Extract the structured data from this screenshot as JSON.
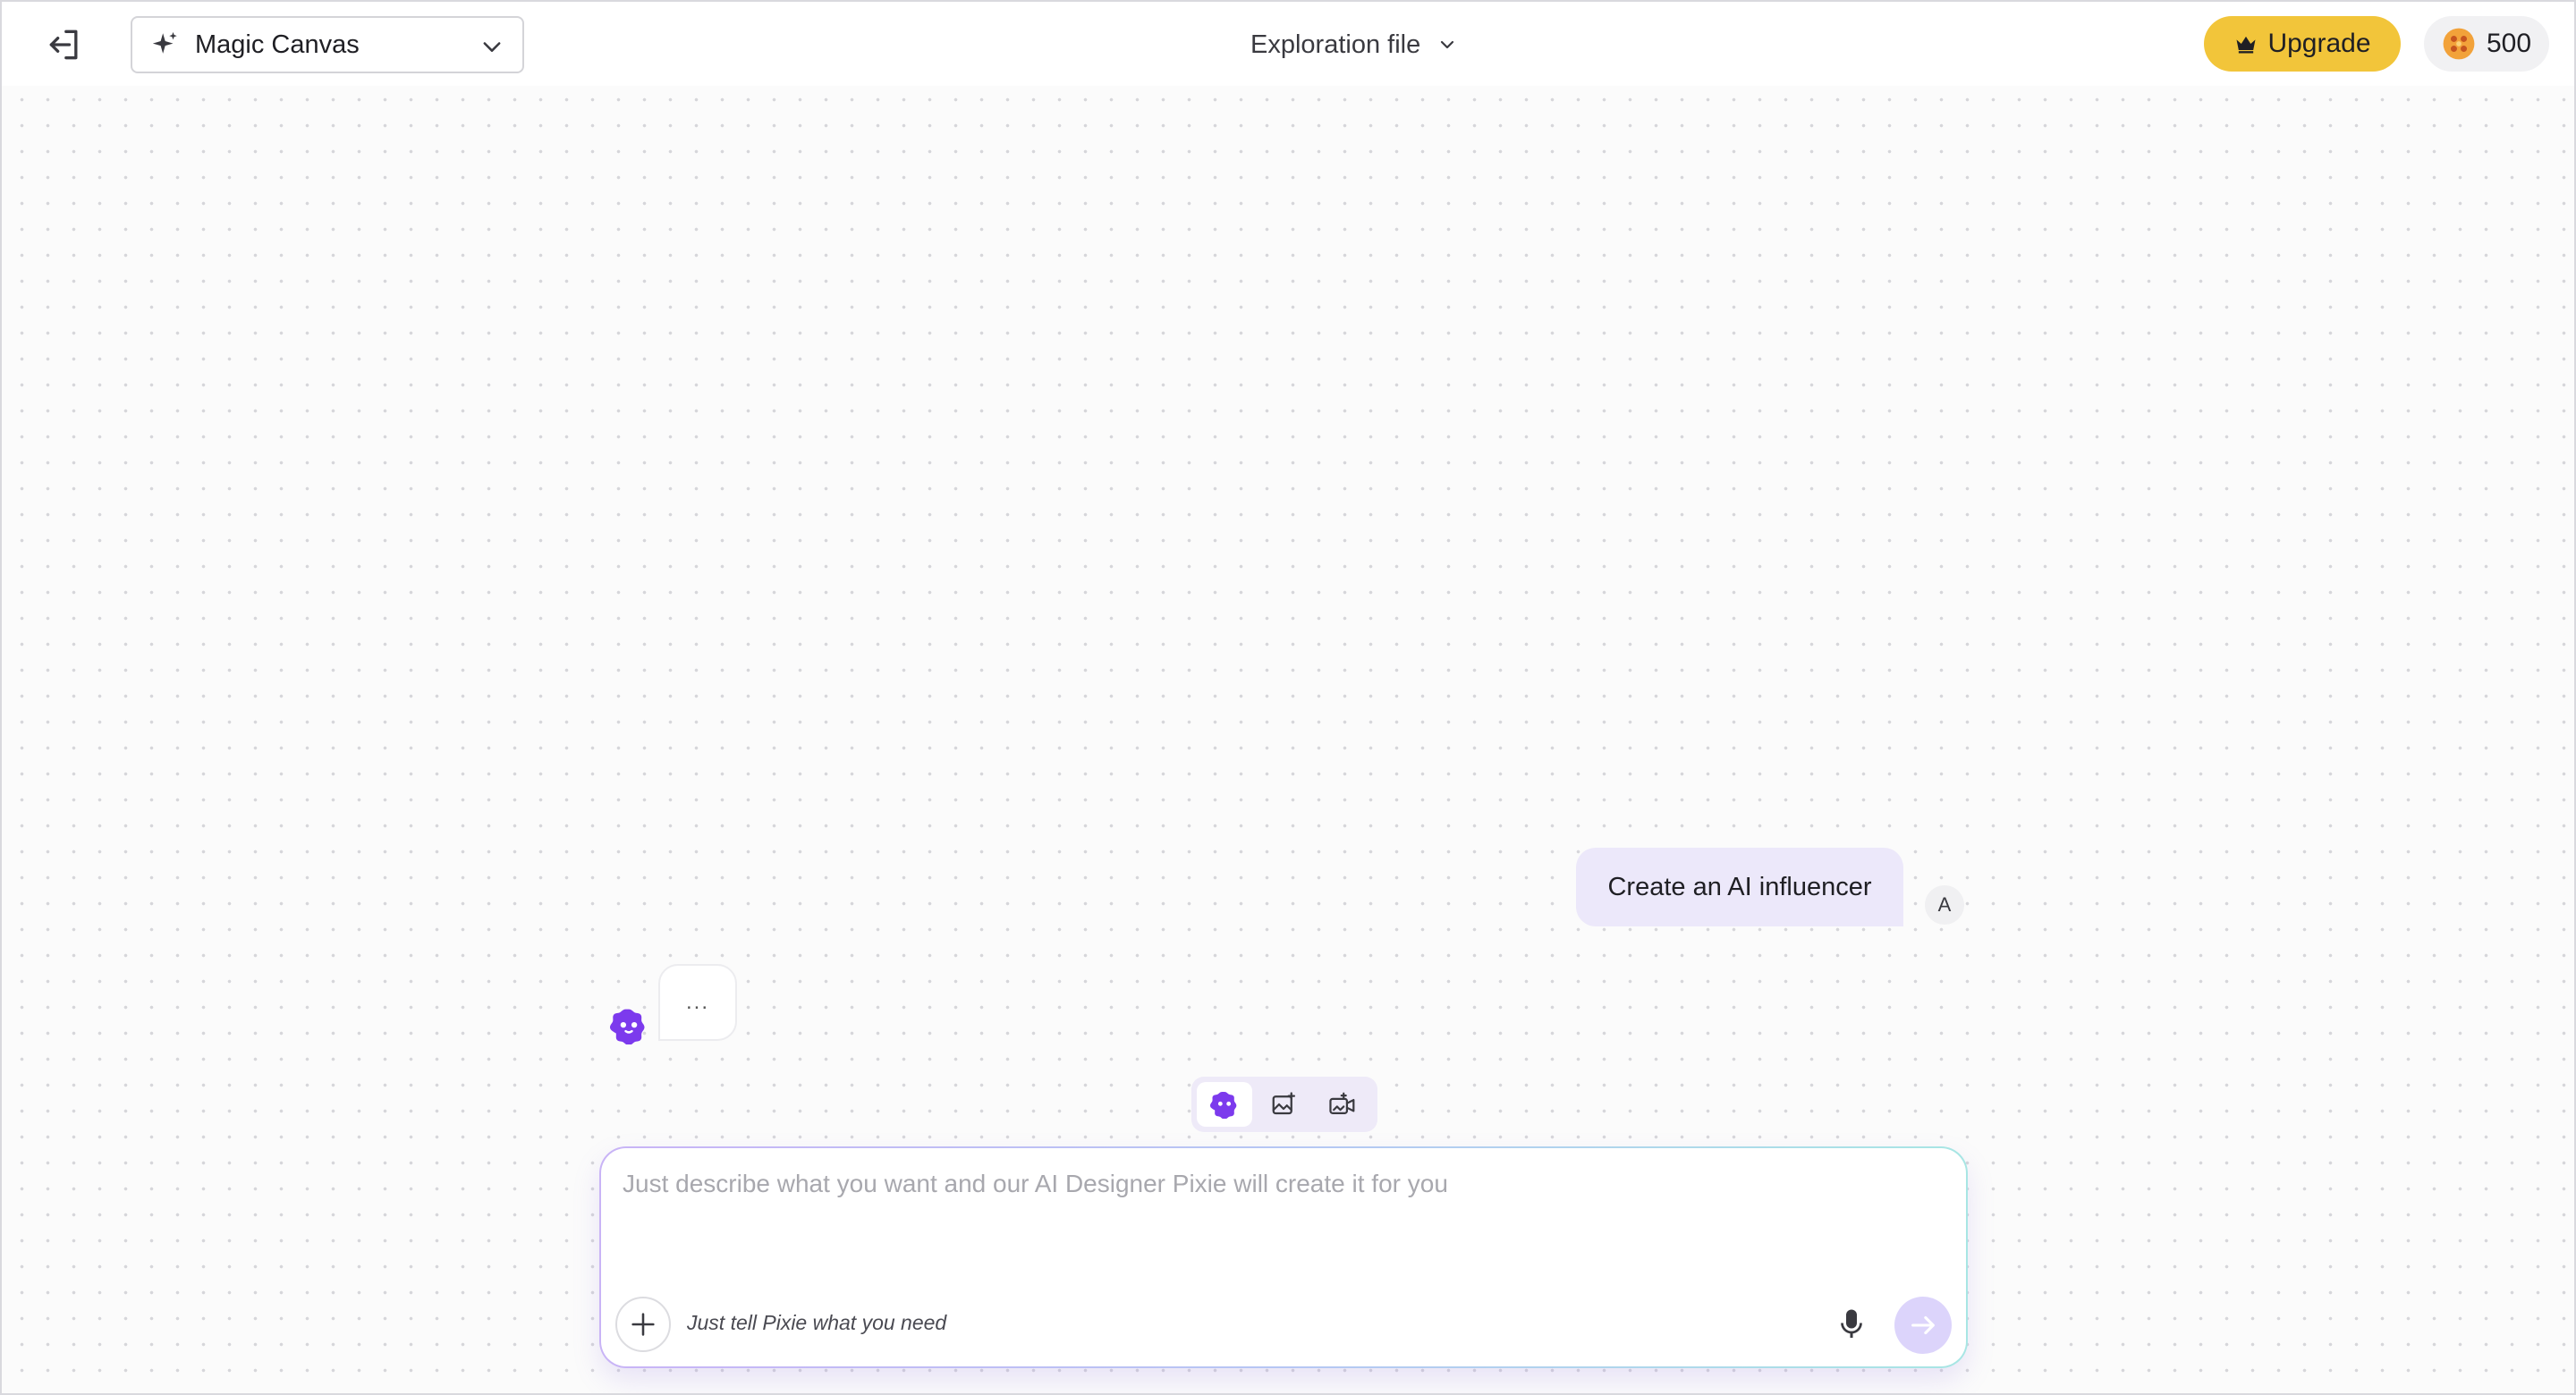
{
  "header": {
    "mode_label": "Magic Canvas",
    "file_title": "Exploration file",
    "upgrade_label": "Upgrade",
    "credits": "500",
    "icons": {
      "exit": "exit-icon",
      "sparkle": "sparkle-icon",
      "chevron": "chevron-down-icon",
      "crown": "crown-icon",
      "coin": "coin-icon"
    }
  },
  "chat": {
    "user_message": "Create an AI influencer",
    "user_avatar": "A",
    "bot_typing": "..."
  },
  "mode_tabs": [
    {
      "name": "pixie-assistant",
      "icon": "pixie-icon",
      "active": true
    },
    {
      "name": "image",
      "icon": "image-generate-icon",
      "active": false
    },
    {
      "name": "video",
      "icon": "video-generate-icon",
      "active": false
    }
  ],
  "composer": {
    "placeholder": "Just describe what you want and our AI Designer Pixie will create it for you",
    "value": "",
    "hint": "Just tell Pixie what you need"
  },
  "colors": {
    "accent_purple": "#7c4dff",
    "upgrade_yellow": "#f2c53a",
    "user_bubble": "#ece8fa",
    "send_button": "#dcd4fb"
  }
}
